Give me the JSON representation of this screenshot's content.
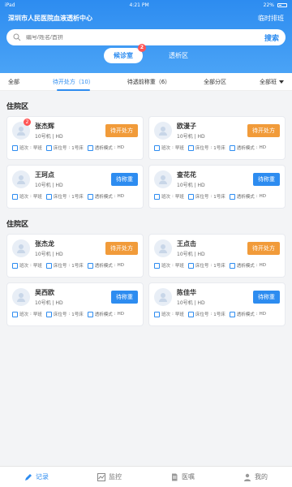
{
  "status": {
    "carrier": "iPad",
    "time": "4:21 PM",
    "battery": "22%"
  },
  "header": {
    "title": "深圳市人民医院血液透析中心",
    "action": "临时排班"
  },
  "search": {
    "placeholder": "编号/姓名/首拼",
    "button": "搜索"
  },
  "segments": [
    {
      "label": "候诊室",
      "badge": "2"
    },
    {
      "label": "透析区"
    }
  ],
  "tabs": [
    "全部",
    "待开处方（10）",
    "待透前称重（6）",
    "全部分区",
    "全部班"
  ],
  "sections": [
    {
      "title": "住院区",
      "cards": [
        {
          "name": "张杰辉",
          "sub": "10号机 | HD",
          "btn": "待开处方",
          "badge": "2"
        },
        {
          "name": "欧漫子",
          "sub": "10号机 | HD",
          "btn": "待开处方"
        },
        {
          "name": "王珂点",
          "sub": "10号机 | HD",
          "btn": "待称重"
        },
        {
          "name": "查花花",
          "sub": "10号机 | HD",
          "btn": "待称重"
        }
      ]
    },
    {
      "title": "住院区",
      "cards": [
        {
          "name": "张杰龙",
          "sub": "10号机 | HD",
          "btn": "待开处方"
        },
        {
          "name": "王点击",
          "sub": "10号机 | HD",
          "btn": "待开处方"
        },
        {
          "name": "吴西欧",
          "sub": "10号机 | HD",
          "btn": "待称重"
        },
        {
          "name": "陈佳华",
          "sub": "10号机 | HD",
          "btn": "待称重"
        }
      ]
    }
  ],
  "meta": {
    "shift_label": "班次",
    "shift": "早班",
    "bed_label": "床位号",
    "bed": "1号床",
    "mode_label": "透析模式",
    "mode": "HD"
  },
  "nav": [
    {
      "label": "记录",
      "icon": "edit-icon",
      "active": true
    },
    {
      "label": "监控",
      "icon": "chart-icon"
    },
    {
      "label": "医嘱",
      "icon": "document-icon"
    },
    {
      "label": "我的",
      "icon": "user-icon"
    }
  ]
}
